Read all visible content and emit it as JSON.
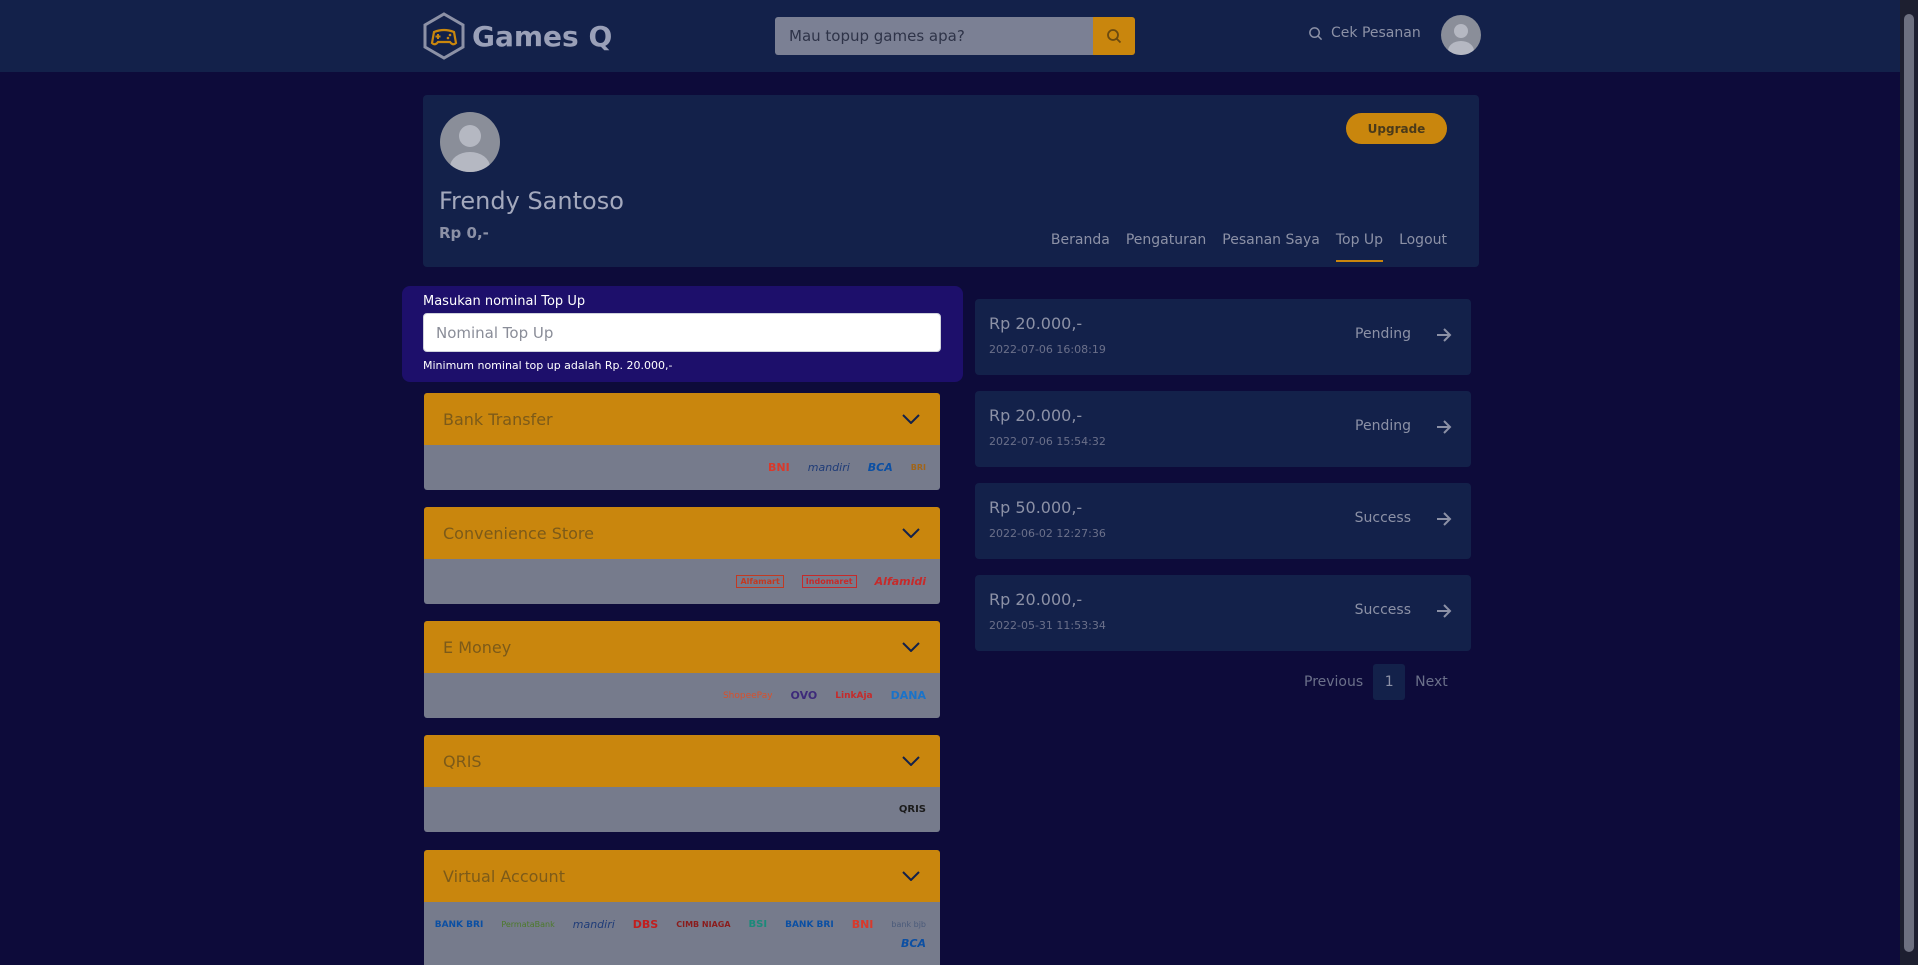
{
  "header": {
    "brand": "Games Q",
    "search_placeholder": "Mau topup games apa?",
    "orders_link": "Cek Pesanan"
  },
  "profile": {
    "name": "Frendy Santoso",
    "balance": "Rp 0,-",
    "upgrade_label": "Upgrade",
    "nav": [
      "Beranda",
      "Pengaturan",
      "Pesanan Saya",
      "Top Up",
      "Logout"
    ],
    "active_nav": "Top Up"
  },
  "topup": {
    "label": "Masukan nominal Top Up",
    "placeholder": "Nominal Top Up",
    "hint": "Minimum nominal top up adalah Rp. 20.000,-"
  },
  "payments": [
    {
      "title": "Bank Transfer",
      "logos": [
        "BNI",
        "mandiri",
        "BCA",
        "BRI"
      ]
    },
    {
      "title": "Convenience Store",
      "logos": [
        "Alfamart",
        "Indomaret",
        "Alfamidi"
      ]
    },
    {
      "title": "E Money",
      "logos": [
        "ShopeePay",
        "OVO",
        "LinkAja",
        "DANA"
      ]
    },
    {
      "title": "QRIS",
      "logos": [
        "QRIS"
      ]
    },
    {
      "title": "Virtual Account",
      "logos": [
        "BANK BRI",
        "PermataBank",
        "mandiri",
        "DBS",
        "CIMB NIAGA",
        "BSI",
        "BANK BRI",
        "BNI",
        "bank bjb",
        "BCA"
      ]
    }
  ],
  "history": [
    {
      "amount": "Rp 20.000,-",
      "date": "2022-07-06 16:08:19",
      "status": "Pending"
    },
    {
      "amount": "Rp 20.000,-",
      "date": "2022-07-06 15:54:32",
      "status": "Pending"
    },
    {
      "amount": "Rp 50.000,-",
      "date": "2022-06-02 12:27:36",
      "status": "Success"
    },
    {
      "amount": "Rp 20.000,-",
      "date": "2022-05-31 11:53:34",
      "status": "Success"
    }
  ],
  "pagination": {
    "previous": "Previous",
    "current": "1",
    "next": "Next"
  },
  "colors": {
    "accent": "#c9860d",
    "page_bg": "#0d0b3a",
    "card_bg": "#13214a",
    "topup_bg": "#1d0f6b"
  }
}
